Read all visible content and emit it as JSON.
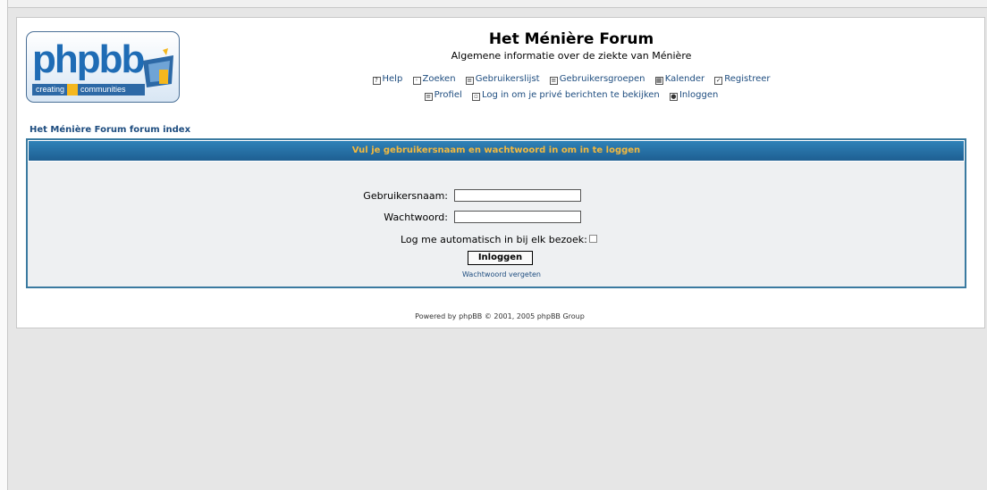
{
  "site": {
    "title": "Het Ménière Forum",
    "description": "Algemene informatie over de ziekte van Ménière"
  },
  "logo": {
    "word": "phpbb",
    "tag_left": "creating",
    "tag_right": "communities"
  },
  "nav": {
    "row1": [
      {
        "label": "Help",
        "icon": "help-icon"
      },
      {
        "label": "Zoeken",
        "icon": "search-icon"
      },
      {
        "label": "Gebruikerslijst",
        "icon": "list-icon"
      },
      {
        "label": "Gebruikersgroepen",
        "icon": "list-icon"
      },
      {
        "label": "Kalender",
        "icon": "calendar-icon"
      },
      {
        "label": "Registreer",
        "icon": "register-icon"
      }
    ],
    "row2": [
      {
        "label": "Profiel",
        "icon": "profile-icon"
      },
      {
        "label": "Log in om je privé berichten te bekijken",
        "icon": "message-icon"
      },
      {
        "label": "Inloggen",
        "icon": "login-icon"
      }
    ]
  },
  "breadcrumb": "Het Ménière Forum forum index",
  "login": {
    "header": "Vul je gebruikersnaam en wachtwoord in om in te loggen",
    "username_label": "Gebruikersnaam:",
    "username_value": "",
    "password_label": "Wachtwoord:",
    "password_value": "",
    "auto_label": "Log me automatisch in bij elk bezoek:",
    "auto_checked": false,
    "button": "Inloggen",
    "forgot": "Wachtwoord vergeten"
  },
  "footer": "Powered by phpBB © 2001, 2005 phpBB Group",
  "colors": {
    "header_bar": "#2f82b8",
    "header_text": "#f4b93e",
    "link": "#1d4c7f"
  }
}
